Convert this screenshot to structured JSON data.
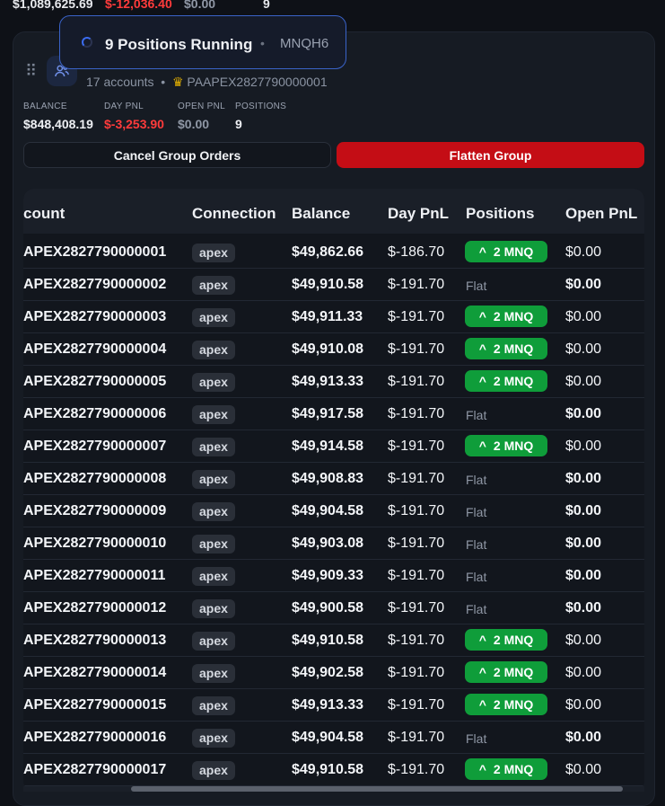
{
  "top_summary": {
    "balance": "$1,089,625.69",
    "day_pnl": "$-12,036.40",
    "open_pnl": "$0.00",
    "positions": "9"
  },
  "toast": {
    "title": "9 Positions Running",
    "separator": "•",
    "symbol": "MNQH6"
  },
  "group": {
    "accounts_text": "17 accounts",
    "separator": "•",
    "leader_account": "PAAPEX2827790000001",
    "stats": {
      "balance_label": "BALANCE",
      "balance": "$848,408.19",
      "day_pnl_label": "DAY PNL",
      "day_pnl": "$-3,253.90",
      "open_pnl_label": "OPEN PNL",
      "open_pnl": "$0.00",
      "positions_label": "POSITIONS",
      "positions": "9"
    },
    "cancel_label": "Cancel Group Orders",
    "flatten_label": "Flatten Group"
  },
  "colors": {
    "negative": "#ff3b3b",
    "long_badge": "#0f9d3a",
    "flatten": "#c40d15",
    "accent": "#3a63c8"
  },
  "table": {
    "headers": {
      "account": "count",
      "connection": "Connection",
      "balance": "Balance",
      "day_pnl": "Day PnL",
      "positions": "Positions",
      "open_pnl": "Open PnL"
    },
    "flat_label": "Flat",
    "rows": [
      {
        "account": "APEX2827790000001",
        "connection": "apex",
        "balance": "$49,862.66",
        "day_pnl": "$-186.70",
        "position": "2 MNQ",
        "open_pnl": "$0.00"
      },
      {
        "account": "APEX2827790000002",
        "connection": "apex",
        "balance": "$49,910.58",
        "day_pnl": "$-191.70",
        "position": "",
        "open_pnl": "$0.00"
      },
      {
        "account": "APEX2827790000003",
        "connection": "apex",
        "balance": "$49,911.33",
        "day_pnl": "$-191.70",
        "position": "2 MNQ",
        "open_pnl": "$0.00"
      },
      {
        "account": "APEX2827790000004",
        "connection": "apex",
        "balance": "$49,910.08",
        "day_pnl": "$-191.70",
        "position": "2 MNQ",
        "open_pnl": "$0.00"
      },
      {
        "account": "APEX2827790000005",
        "connection": "apex",
        "balance": "$49,913.33",
        "day_pnl": "$-191.70",
        "position": "2 MNQ",
        "open_pnl": "$0.00"
      },
      {
        "account": "APEX2827790000006",
        "connection": "apex",
        "balance": "$49,917.58",
        "day_pnl": "$-191.70",
        "position": "",
        "open_pnl": "$0.00"
      },
      {
        "account": "APEX2827790000007",
        "connection": "apex",
        "balance": "$49,914.58",
        "day_pnl": "$-191.70",
        "position": "2 MNQ",
        "open_pnl": "$0.00"
      },
      {
        "account": "APEX2827790000008",
        "connection": "apex",
        "balance": "$49,908.83",
        "day_pnl": "$-191.70",
        "position": "",
        "open_pnl": "$0.00"
      },
      {
        "account": "APEX2827790000009",
        "connection": "apex",
        "balance": "$49,904.58",
        "day_pnl": "$-191.70",
        "position": "",
        "open_pnl": "$0.00"
      },
      {
        "account": "APEX2827790000010",
        "connection": "apex",
        "balance": "$49,903.08",
        "day_pnl": "$-191.70",
        "position": "",
        "open_pnl": "$0.00"
      },
      {
        "account": "APEX2827790000011",
        "connection": "apex",
        "balance": "$49,909.33",
        "day_pnl": "$-191.70",
        "position": "",
        "open_pnl": "$0.00"
      },
      {
        "account": "APEX2827790000012",
        "connection": "apex",
        "balance": "$49,900.58",
        "day_pnl": "$-191.70",
        "position": "",
        "open_pnl": "$0.00"
      },
      {
        "account": "APEX2827790000013",
        "connection": "apex",
        "balance": "$49,910.58",
        "day_pnl": "$-191.70",
        "position": "2 MNQ",
        "open_pnl": "$0.00"
      },
      {
        "account": "APEX2827790000014",
        "connection": "apex",
        "balance": "$49,902.58",
        "day_pnl": "$-191.70",
        "position": "2 MNQ",
        "open_pnl": "$0.00"
      },
      {
        "account": "APEX2827790000015",
        "connection": "apex",
        "balance": "$49,913.33",
        "day_pnl": "$-191.70",
        "position": "2 MNQ",
        "open_pnl": "$0.00"
      },
      {
        "account": "APEX2827790000016",
        "connection": "apex",
        "balance": "$49,904.58",
        "day_pnl": "$-191.70",
        "position": "",
        "open_pnl": "$0.00"
      },
      {
        "account": "APEX2827790000017",
        "connection": "apex",
        "balance": "$49,910.58",
        "day_pnl": "$-191.70",
        "position": "2 MNQ",
        "open_pnl": "$0.00"
      }
    ]
  }
}
